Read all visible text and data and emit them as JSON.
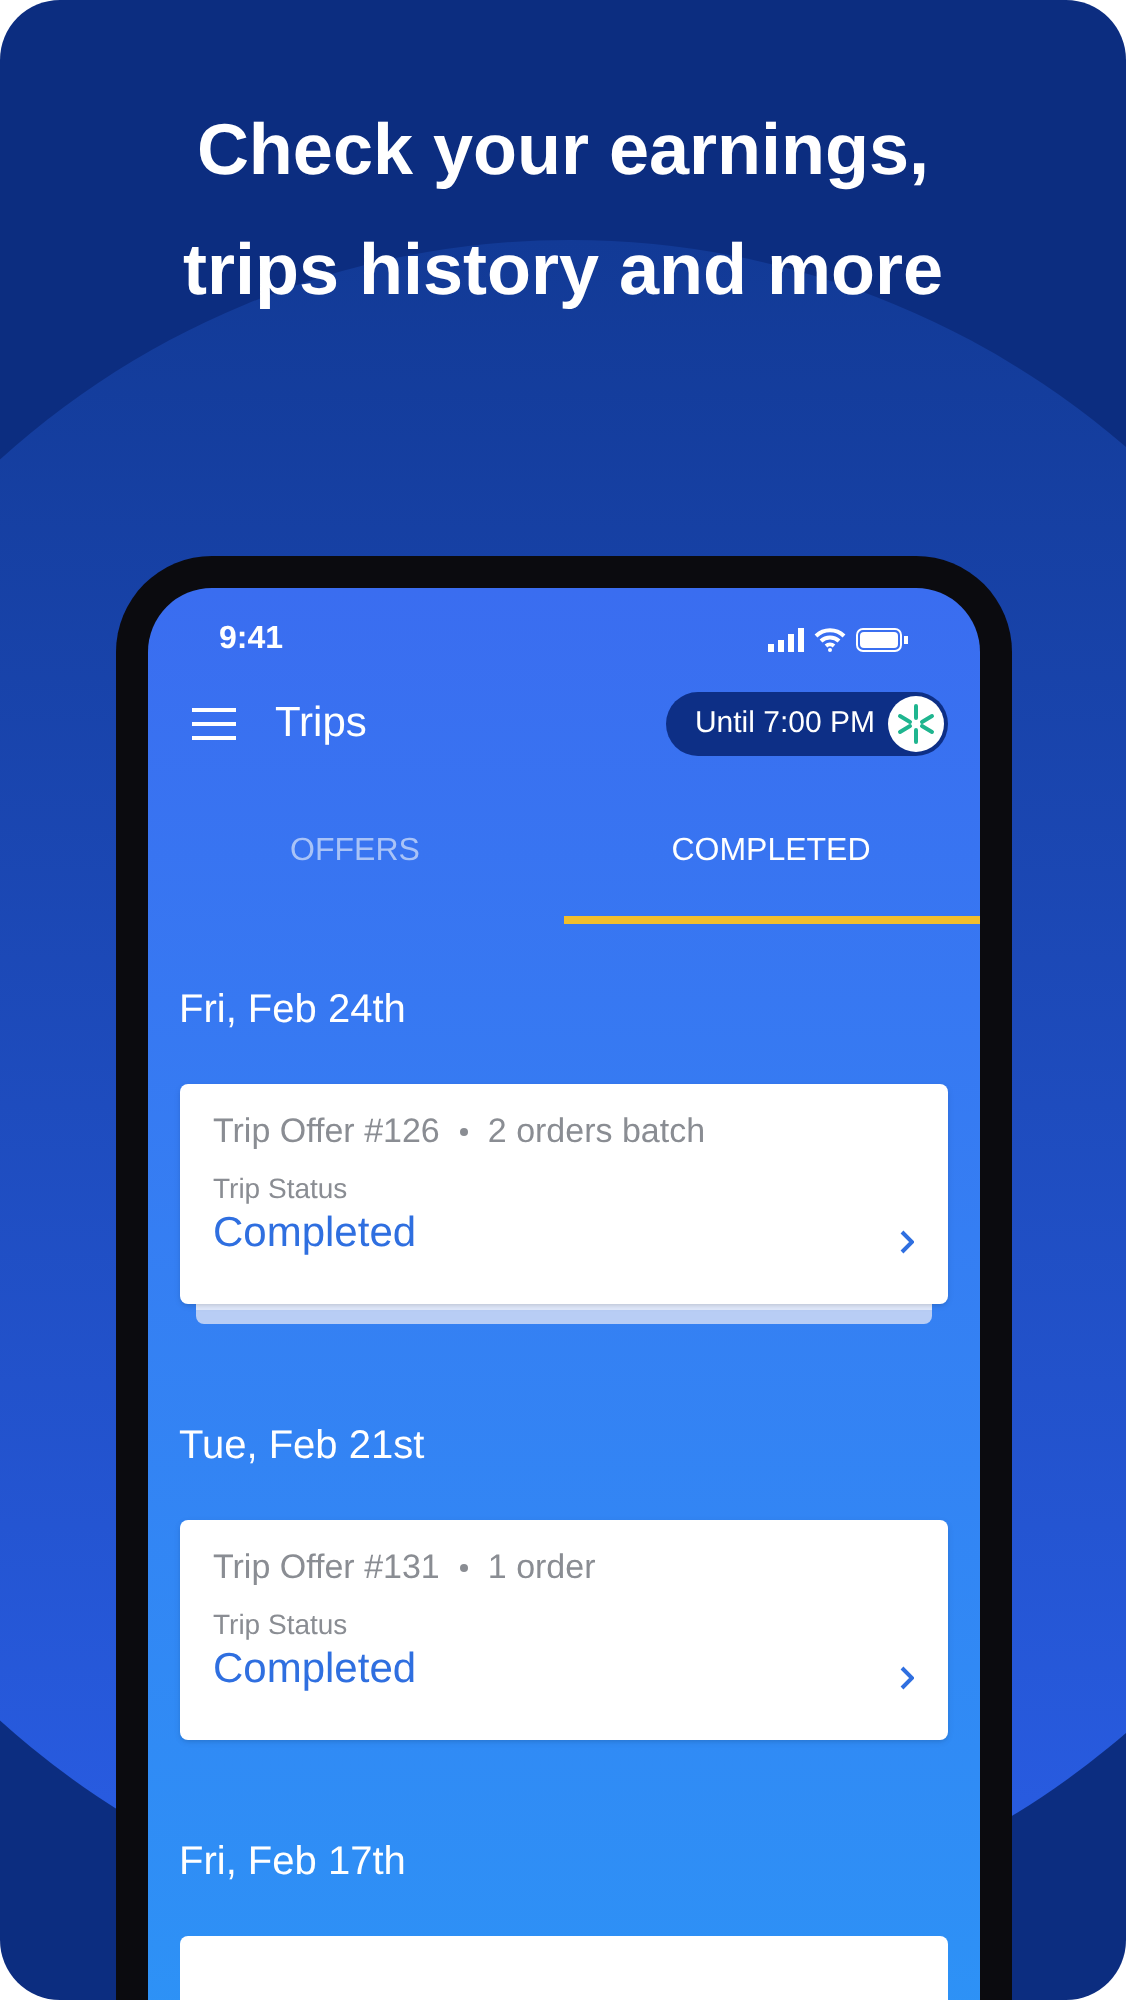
{
  "headline": "Check your earnings, trips history and more",
  "status_bar": {
    "time": "9:41"
  },
  "header": {
    "title": "Trips",
    "shift_pill": "Until 7:00 PM"
  },
  "tabs": [
    {
      "label": "OFFERS",
      "selected": false
    },
    {
      "label": "COMPLETED",
      "selected": true
    }
  ],
  "sections": [
    {
      "date": "Fri, Feb 24th",
      "trip": {
        "title": "Trip Offer #126",
        "detail": "2 orders batch",
        "status_label": "Trip Status",
        "status": "Completed",
        "stacked": true
      }
    },
    {
      "date": "Tue, Feb 21st",
      "trip": {
        "title": "Trip Offer #131",
        "detail": "1 order",
        "status_label": "Trip Status",
        "status": "Completed",
        "stacked": false
      }
    },
    {
      "date": "Fri, Feb 17th",
      "trip": {
        "kind": "cut"
      }
    }
  ]
}
